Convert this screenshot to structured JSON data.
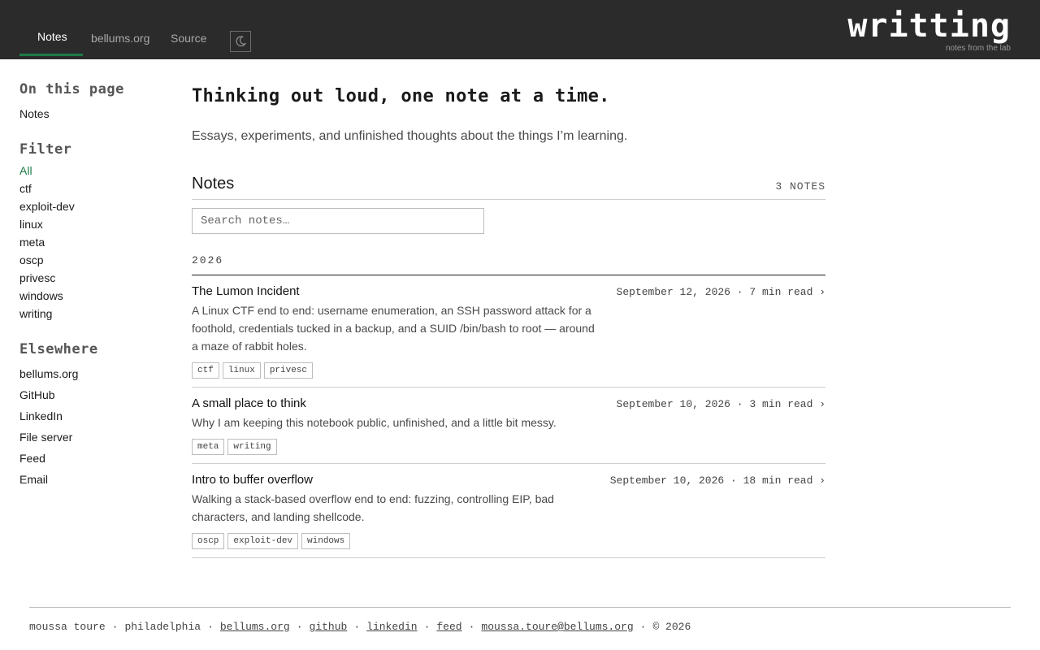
{
  "header": {
    "tabs": [
      {
        "label": "Notes"
      },
      {
        "label": "bellums.org"
      },
      {
        "label": "Source"
      }
    ],
    "theme_icon": "moon-icon",
    "brand": "writting",
    "tagline": "notes from the lab"
  },
  "sidebar": {
    "on_this_page": {
      "heading": "On this page",
      "items": [
        "Notes"
      ]
    },
    "filter": {
      "heading": "Filter",
      "items": [
        "All",
        "ctf",
        "exploit-dev",
        "linux",
        "meta",
        "oscp",
        "privesc",
        "windows",
        "writing"
      ],
      "active": "All"
    },
    "elsewhere": {
      "heading": "Elsewhere",
      "items": [
        "bellums.org",
        "GitHub",
        "LinkedIn",
        "File server",
        "Feed",
        "Email"
      ]
    }
  },
  "main": {
    "title": "Thinking out loud, one note at a time.",
    "subtitle": "Essays, experiments, and unfinished thoughts about the things I’m learning.",
    "section_title": "Notes",
    "count": "3 NOTES",
    "search_placeholder": "Search notes…",
    "year": "2026",
    "notes": [
      {
        "title": "The Lumon Incident",
        "meta": "September 12, 2026 · 7 min read ›",
        "desc": "A Linux CTF end to end: username enumeration, an SSH password attack for a foothold, credentials tucked in a backup, and a SUID /bin/bash to root — around a maze of rabbit holes.",
        "tags": [
          "ctf",
          "linux",
          "privesc"
        ]
      },
      {
        "title": "A small place to think",
        "meta": "September 10, 2026 · 3 min read ›",
        "desc": "Why I am keeping this notebook public, unfinished, and a little bit messy.",
        "tags": [
          "meta",
          "writing"
        ]
      },
      {
        "title": "Intro to buffer overflow",
        "meta": "September 10, 2026 · 18 min read ›",
        "desc": "Walking a stack-based overflow end to end: fuzzing, controlling EIP, bad characters, and landing shellcode.",
        "tags": [
          "oscp",
          "exploit-dev",
          "windows"
        ]
      }
    ]
  },
  "footer": {
    "name": "moussa toure",
    "city": "philadelphia",
    "links": [
      "bellums.org",
      "github",
      "linkedin",
      "feed",
      "moussa.toure@bellums.org"
    ],
    "copyright": "© 2026"
  },
  "colors": {
    "accent": "#1e7a46",
    "header_bg": "#2b2b2b"
  }
}
